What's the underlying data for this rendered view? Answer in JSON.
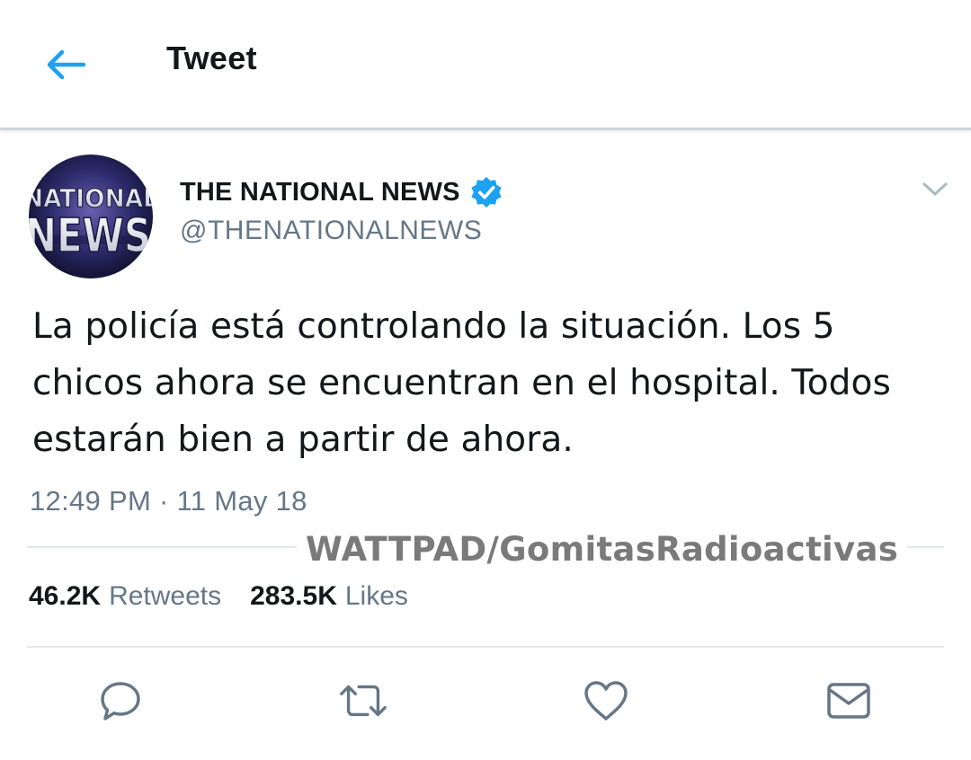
{
  "header": {
    "title": "Tweet",
    "back_icon": "back-arrow-icon"
  },
  "tweet": {
    "author": {
      "name": "THE NATIONAL NEWS",
      "handle": "@THENATIONALNEWS",
      "verified": true,
      "avatar_text_top": "NATIONAL",
      "avatar_text_bottom": "NEWS"
    },
    "text": "La policía está controlando la situación. Los 5 chicos ahora se encuentran en el hospital. Todos estarán bien a partir de ahora.",
    "timestamp": "12:49 PM · 11 May 18"
  },
  "stats": {
    "retweets_count": "46.2K",
    "retweets_label": "Retweets",
    "likes_count": "283.5K",
    "likes_label": "Likes"
  },
  "watermark": "WATTPAD/GomitasRadioactivas",
  "actions": [
    "reply-icon",
    "retweet-icon",
    "like-icon",
    "share-icon"
  ],
  "colors": {
    "accent": "#1da1f2",
    "text": "#14171a",
    "secondary": "#657786",
    "icon": "#657786",
    "divider": "#e1e8ed"
  }
}
